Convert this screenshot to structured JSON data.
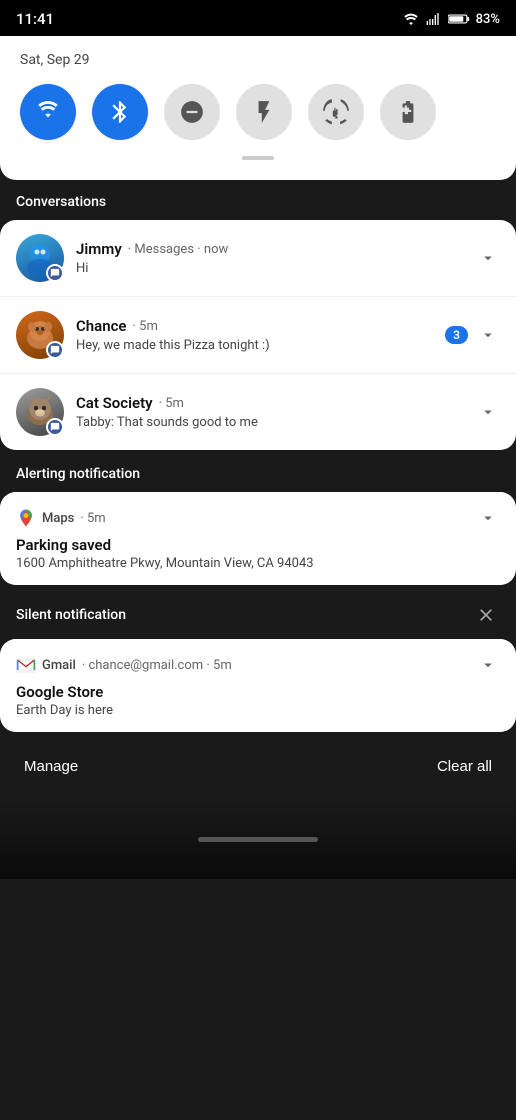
{
  "statusBar": {
    "time": "11:41",
    "batteryPercent": "83%",
    "wifi": true,
    "signal": true,
    "battery": true
  },
  "quickSettings": {
    "date": "Sat, Sep 29",
    "toggles": [
      {
        "id": "wifi",
        "label": "Wi-Fi",
        "active": true
      },
      {
        "id": "bluetooth",
        "label": "Bluetooth",
        "active": true
      },
      {
        "id": "dnd",
        "label": "Do Not Disturb",
        "active": false
      },
      {
        "id": "flashlight",
        "label": "Flashlight",
        "active": false
      },
      {
        "id": "rotate",
        "label": "Auto Rotate",
        "active": false
      },
      {
        "id": "battery-saver",
        "label": "Battery Saver",
        "active": false
      }
    ]
  },
  "sections": {
    "conversations": {
      "header": "Conversations",
      "items": [
        {
          "name": "Jimmy",
          "app": "Messages",
          "time": "now",
          "message": "Hi",
          "badge": null
        },
        {
          "name": "Chance",
          "app": "",
          "time": "5m",
          "message": "Hey, we made this Pizza tonight :)",
          "badge": "3"
        },
        {
          "name": "Cat Society",
          "app": "",
          "time": "5m",
          "message": "Tabby: That sounds good to me",
          "badge": null
        }
      ]
    },
    "alerting": {
      "header": "Alerting notification",
      "app": "Maps",
      "time": "5m",
      "title": "Parking saved",
      "body": "1600 Amphitheatre Pkwy, Mountain View, CA 94043"
    },
    "silent": {
      "header": "Silent notification",
      "app": "Gmail",
      "email": "chance@gmail.com",
      "time": "5m",
      "title": "Google Store",
      "body": "Earth Day is here"
    }
  },
  "bottomBar": {
    "manage": "Manage",
    "clearAll": "Clear all"
  }
}
